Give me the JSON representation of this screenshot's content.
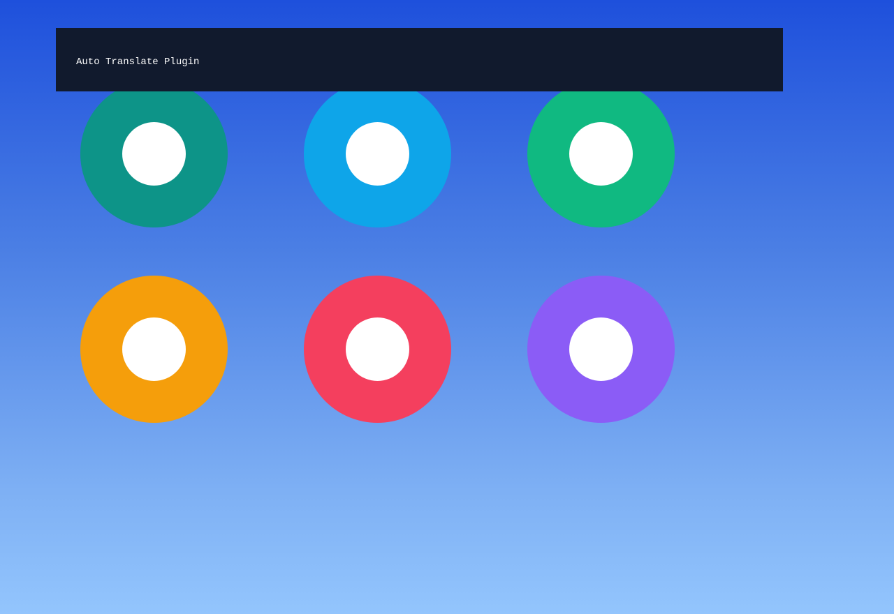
{
  "header": {
    "title": "Auto Translate Plugin"
  },
  "colors": {
    "header_bg": "#111a2d",
    "background_top": "#1e50dc",
    "background_bottom": "#93c5fd",
    "hole": "#ffffff"
  },
  "tiles": [
    {
      "color": "#0d9488"
    },
    {
      "color": "#0ea5e9"
    },
    {
      "color": "#10b981"
    },
    {
      "color": "#f59e0b"
    },
    {
      "color": "#f43f5e"
    },
    {
      "color": "#8b5cf6"
    }
  ]
}
